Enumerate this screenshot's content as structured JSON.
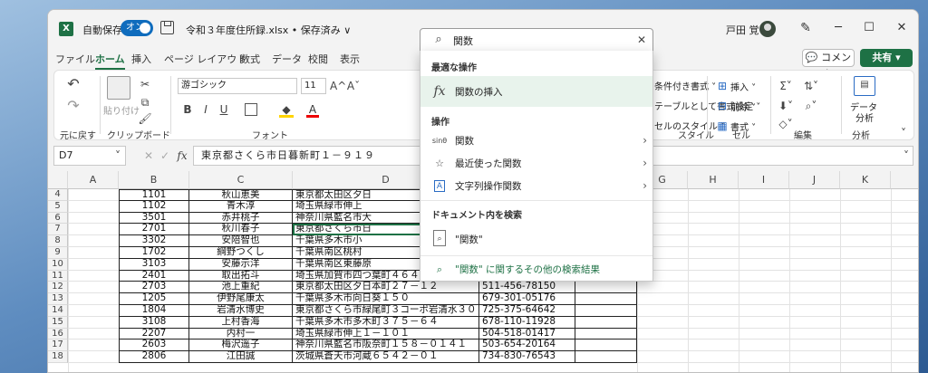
{
  "title_bar": {
    "autosave_label": "自動保存",
    "autosave_state": "オン",
    "filename": "令和３年度住所録.xlsx • 保存済み ∨",
    "user_name": "戸田 覚",
    "minimize": "─",
    "maximize": "☐",
    "close": "✕"
  },
  "search": {
    "query": "関数",
    "clear": "✕",
    "sections": {
      "best_action": "最適な操作",
      "actions": "操作",
      "document": "ドキュメント内を検索"
    },
    "best_item": {
      "icon": "fx",
      "label": "関数の挿入"
    },
    "action_items": [
      {
        "icon": "sinθ",
        "label": "関数",
        "chevron": "›"
      },
      {
        "icon": "☆",
        "label": "最近使った関数",
        "chevron": "›"
      },
      {
        "icon": "A",
        "label": "文字列操作関数",
        "chevron": "›"
      }
    ],
    "doc_item": {
      "label": "\"関数\""
    },
    "more_results": "\"関数\" に関するその他の検索結果"
  },
  "tabs": [
    "ファイル",
    "ホーム",
    "挿入",
    "ページ レイアウト",
    "数式",
    "データ",
    "校閲",
    "表示"
  ],
  "active_tab": "ホーム",
  "comment_button": "コメント",
  "share_button": "共有 ▾",
  "ribbon": {
    "undo_label": "元に戻す",
    "paste_label": "貼り付け",
    "clipboard_label": "クリップボード",
    "font_name": "游ゴシック",
    "font_size": "11",
    "grow_font": "A^",
    "shrink_font": "Aˇ",
    "bold": "B",
    "italic": "I",
    "underline": "U",
    "font_color_glyph": "A",
    "font_label": "フォント",
    "cond_format": "条件付き書式 ˅",
    "table_format": "テーブルとして書式設定 ˅",
    "cell_style": "セルのスタイル ˅",
    "style_label": "スタイル",
    "insert": "挿入 ˅",
    "delete": "削除 ˅",
    "format": "書式 ˅",
    "cells_label": "セル",
    "edit_label": "編集",
    "data_analysis_1": "データ",
    "data_analysis_2": "分析",
    "analysis_label": "分析"
  },
  "formula_bar": {
    "name_box": "D7",
    "content": "東京都さくら市日暮新町１－９１９"
  },
  "columns": [
    "A",
    "B",
    "C",
    "D",
    "E",
    "F",
    "G",
    "H",
    "I",
    "J",
    "K"
  ],
  "rows": [
    {
      "num": "4",
      "b": "1101",
      "c": "秋山恵美",
      "d": "東京都太田区夕日",
      "e": "",
      "f": ""
    },
    {
      "num": "5",
      "b": "1102",
      "c": "青木淳",
      "d": "埼玉県緑市伸上",
      "e": "",
      "f": ""
    },
    {
      "num": "6",
      "b": "3501",
      "c": "赤井桃子",
      "d": "神奈川県藍名市大",
      "e": "",
      "f": ""
    },
    {
      "num": "7",
      "b": "2701",
      "b2": "",
      "c": "秋川春子",
      "d": "東京都さくら市日",
      "e": "",
      "f": ""
    },
    {
      "num": "8",
      "b": "3302",
      "c": "安陪智也",
      "d": "千葉県多木市小",
      "e": "",
      "f": ""
    },
    {
      "num": "9",
      "b": "1702",
      "c": "綱野つくし",
      "d": "千葉県南区桃村",
      "e": "",
      "f": ""
    },
    {
      "num": "10",
      "b": "3103",
      "c": "安藤示洋",
      "d": "千葉県南区東藤原",
      "e": "",
      "f": ""
    },
    {
      "num": "11",
      "b": "2401",
      "c": "取出拓斗",
      "d": "埼玉県加賀市四つ葉町４６４９－１６３２",
      "e": "758-271-21719",
      "f": "本年度会計"
    },
    {
      "num": "12",
      "b": "2703",
      "c": "池上重紀",
      "d": "東京都太田区夕日本町２７－１２",
      "e": "511-456-78150",
      "f": ""
    },
    {
      "num": "13",
      "b": "1205",
      "c": "伊野尾康太",
      "d": "千葉県多木市向日葵１５０",
      "e": "679-301-05176",
      "f": ""
    },
    {
      "num": "14",
      "b": "1804",
      "c": "岩清水博史",
      "d": "東京都さくら市緑尾町３コーポ岩清水３０１",
      "e": "725-375-64642",
      "f": ""
    },
    {
      "num": "15",
      "b": "3108",
      "c": "上村香海",
      "d": "千葉県多木市多木町３７５－６４",
      "e": "678-110-11928",
      "f": ""
    },
    {
      "num": "16",
      "b": "2207",
      "c": "内村一",
      "d": "埼玉県緑市伸上１－１０１",
      "e": "504-518-01417",
      "f": ""
    },
    {
      "num": "17",
      "b": "2603",
      "c": "梅沢遥子",
      "d": "神奈川県藍名市阪奈町１５８－０１４１",
      "e": "503-654-20164",
      "f": ""
    },
    {
      "num": "18",
      "b": "2806",
      "c": "江田誠",
      "d": "茨城県蒼天市河蔵６５４２－０１",
      "e": "734-830-76543",
      "f": ""
    }
  ],
  "colors": {
    "excel_green": "#1e7145",
    "accent_blue": "#0f6cbd"
  }
}
